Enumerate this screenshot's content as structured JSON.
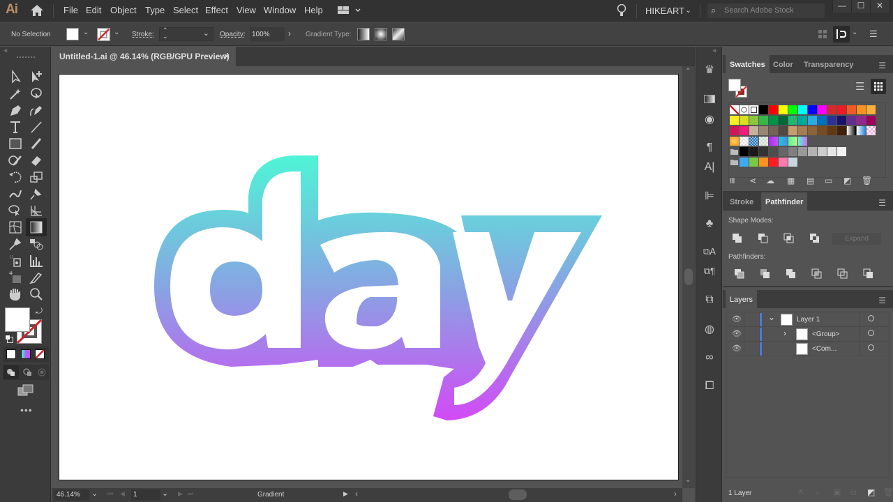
{
  "app": {
    "logo": "Ai",
    "workspace": "HIKEART",
    "search_placeholder": "Search Adobe Stock"
  },
  "menu": [
    "File",
    "Edit",
    "Object",
    "Type",
    "Select",
    "Effect",
    "View",
    "Window",
    "Help"
  ],
  "window_controls": {
    "minimize": "—",
    "maximize": "☐",
    "close": "✕"
  },
  "control_bar": {
    "selection": "No Selection",
    "stroke_label": "Stroke:",
    "stroke_value": "",
    "opacity_label": "Opacity:",
    "opacity_value": "100%",
    "gradient_type_label": "Gradient Type:"
  },
  "document": {
    "tab_title": "Untitled-1.ai @ 46.14% (RGB/GPU Preview)",
    "close": "×"
  },
  "artwork": {
    "text": "day",
    "fill": "#ffffff",
    "gradient_top": "#4ef5d6",
    "gradient_bottom": "#d24bf5"
  },
  "status_bar": {
    "zoom": "46.14%",
    "artboard": "1",
    "status_text": "Gradient"
  },
  "swatches_panel": {
    "tabs": [
      "Swatches",
      "Color",
      "Transparency"
    ],
    "rows": [
      [
        "none",
        "registration",
        "white",
        "#000000",
        "#ff0000",
        "#ffff00",
        "#00ff00",
        "#00ffff",
        "#0000ff",
        "#ff00ff",
        "#d22b2b",
        "#ed1c24",
        "#f15a24",
        "#f7931e",
        "#fbb03b"
      ],
      [
        "#fcee21",
        "#d9e021",
        "#8cc63f",
        "#39b54a",
        "#009245",
        "#006837",
        "#22b573",
        "#00a99d",
        "#29abe2",
        "#0071bc",
        "#2e3192",
        "#1b1464",
        "#662d91",
        "#93278f",
        "#9e005d"
      ],
      [
        "#d4145a",
        "#ed1e79",
        "#c7b299",
        "#998675",
        "#736357",
        "#534741",
        "#c69c6d",
        "#a67c52",
        "#8c6239",
        "#754c24",
        "#603813",
        "#42210b",
        "grad-bw",
        "grad-blue",
        "pattern-pink"
      ],
      [
        "grad-orange",
        "pattern-dots",
        "pattern-blue",
        "pattern-green",
        "grad-purple",
        "grad-teal",
        "grad-green",
        "grad-lilac"
      ],
      [
        "folder",
        "#000000",
        "#1a1a1a",
        "#333333",
        "#4d4d4d",
        "#666666",
        "#808080",
        "#999999",
        "#b3b3b3",
        "#cccccc",
        "#e6e6e6",
        "#f2f2f2"
      ],
      [
        "folder",
        "#3fa9f5",
        "#7ac943",
        "#ff931e",
        "#ff1d25",
        "#ff7bac",
        "#c7d6e0"
      ]
    ]
  },
  "pathfinder_panel": {
    "tabs": [
      "Stroke",
      "Pathfinder"
    ],
    "shape_modes_label": "Shape Modes:",
    "expand_label": "Expand",
    "pathfinders_label": "Pathfinders:"
  },
  "layers_panel": {
    "title": "Layers",
    "rows": [
      {
        "name": "Layer 1",
        "expanded": true,
        "indent": 0
      },
      {
        "name": "<Group>",
        "expanded": false,
        "indent": 1
      },
      {
        "name": "<Com...",
        "expanded": null,
        "indent": 1
      }
    ],
    "footer_count": "1 Layer"
  }
}
